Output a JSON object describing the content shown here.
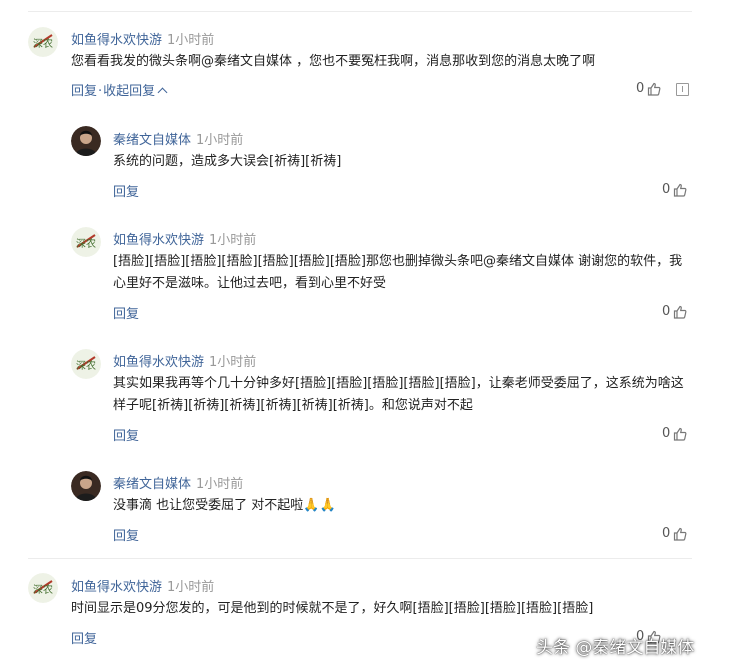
{
  "comments": [
    {
      "user": "如鱼得水欢快游",
      "time": "1小时前",
      "text": "您看看我发的微头条啊@秦绪文自媒体 ，您也不要冤枉我啊，消息那收到您的消息太晚了啊",
      "reply_label": "回复",
      "separator": "·",
      "collapse_label": "收起回复",
      "likes": "0"
    }
  ],
  "replies": [
    {
      "user": "秦绪文自媒体",
      "time": "1小时前",
      "text": "系统的问题，造成多大误会[祈祷][祈祷]",
      "reply_label": "回复",
      "likes": "0"
    },
    {
      "user": "如鱼得水欢快游",
      "time": "1小时前",
      "text": "[捂脸][捂脸][捂脸][捂脸][捂脸][捂脸][捂脸]那您也删掉微头条吧@秦绪文自媒体 谢谢您的软件，我心里好不是滋味。让他过去吧，看到心里不好受",
      "reply_label": "回复",
      "likes": "0"
    },
    {
      "user": "如鱼得水欢快游",
      "time": "1小时前",
      "text": "其实如果我再等个几十分钟多好[捂脸][捂脸][捂脸][捂脸][捂脸]，让秦老师受委屈了，这系统为啥这样子呢[祈祷][祈祷][祈祷][祈祷][祈祷][祈祷]。和您说声对不起",
      "reply_label": "回复",
      "likes": "0"
    },
    {
      "user": "秦绪文自媒体",
      "time": "1小时前",
      "text": "没事滴 也让您受委屈了 对不起啦🙏🙏",
      "reply_label": "回复",
      "likes": "0"
    }
  ],
  "bottom_comment": {
    "user": "如鱼得水欢快游",
    "time": "1小时前",
    "text": "时间显示是09分您发的，可是他到的时候就不是了，好久啊[捂脸][捂脸][捂脸][捂脸][捂脸]",
    "reply_label": "回复",
    "likes": "0"
  },
  "avatar_text": "深农",
  "watermark": "头条 @秦绪文自媒体",
  "colors": {
    "link": "#406599",
    "meta": "#999999",
    "text": "#222222"
  }
}
